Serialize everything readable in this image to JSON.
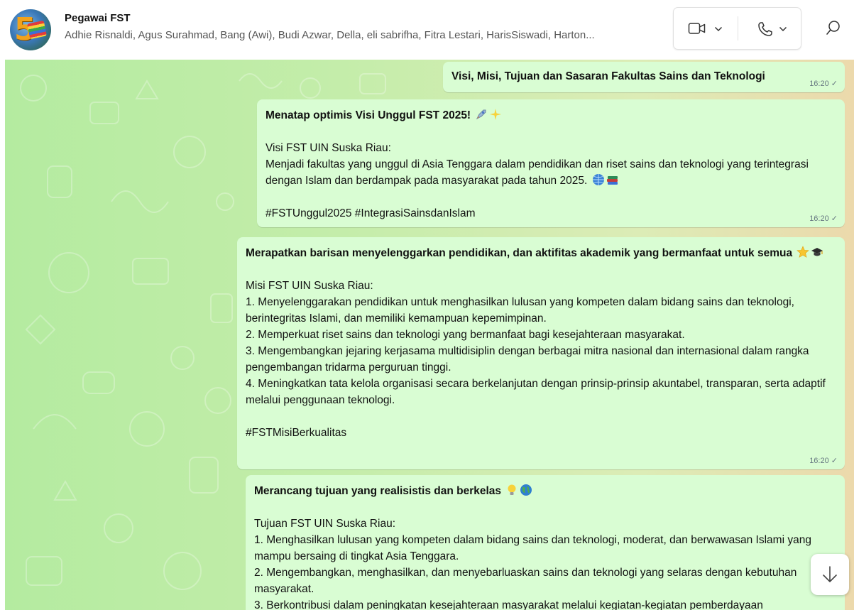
{
  "header": {
    "group_name": "Pegawai FST",
    "members": "Adhie Risnaldi, Agus Surahmad, Bang (Awi), Budi Azwar, Della, eli sabrifha, Fitra Lestari, HarisSiswadi, Harton...",
    "icons": {
      "avatar": "group-avatar-5",
      "video": "video-call-icon",
      "voice": "phone-icon",
      "chevron": "chevron-down-icon",
      "search": "search-icon"
    }
  },
  "messages": [
    {
      "lines": [
        "Visi, Misi, Tujuan dan Sasaran Fakultas Sains dan Teknologi"
      ],
      "time": "16:20"
    },
    {
      "title": "Menatap optimis Visi Unggul FST 2025!",
      "title_emoji": [
        "rocket",
        "sparkles"
      ],
      "heading": "Visi FST UIN Suska Riau:",
      "body": "Menjadi fakultas yang unggul di Asia Tenggara dalam pendidikan dan riset sains dan teknologi yang terintegrasi dengan Islam dan berdampak pada masyarakat pada tahun 2025.",
      "body_emoji": [
        "globe",
        "books"
      ],
      "hashtags": "#FSTUnggul2025 #IntegrasiSainsdanIslam",
      "time": "16:20"
    },
    {
      "title": "Merapatkan barisan menyelenggarkan pendidikan, dan aktifitas akademik yang bermanfaat untuk semua",
      "title_emoji": [
        "star",
        "graduation-cap"
      ],
      "heading": "Misi FST UIN Suska Riau:",
      "items": [
        "1. Menyelenggarakan pendidikan untuk menghasilkan lulusan yang kompeten dalam bidang sains dan teknologi, berintegritas Islami, dan memiliki kemampuan kepemimpinan.",
        "2. Memperkuat riset sains dan teknologi yang bermanfaat bagi kesejahteraan masyarakat.",
        "3. Mengembangkan jejaring kerjasama multidisiplin dengan berbagai mitra nasional dan internasional dalam rangka pengembangan tridarma perguruan tinggi.",
        "4. Meningkatkan tata kelola organisasi secara berkelanjutan dengan prinsip-prinsip akuntabel, transparan, serta adaptif melalui penggunaan teknologi."
      ],
      "hashtags": "#FSTMisiBerkualitas",
      "time": "16:20"
    },
    {
      "title": "Merancang tujuan yang realisistis dan berkelas",
      "title_emoji": [
        "light-bulb",
        "globe"
      ],
      "heading": "Tujuan FST UIN Suska Riau:",
      "items": [
        "1. Menghasilkan lulusan yang kompeten dalam bidang sains dan teknologi, moderat, dan berwawasan Islami yang mampu bersaing di tingkat Asia Tenggara.",
        "2. Mengembangkan, menghasilkan, dan menyebarluaskan sains dan teknologi yang selaras dengan kebutuhan masyarakat.",
        "3. Berkontribusi dalam peningkatan kesejahteraan masyarakat melalui kegiatan-kegiatan pemberdayaan"
      ]
    }
  ],
  "colors": {
    "bubble": "#d9fdd3",
    "chat_bg_left": "#b4eba0",
    "chat_bg_right": "#ecd9ac",
    "meta_text": "#667781"
  }
}
